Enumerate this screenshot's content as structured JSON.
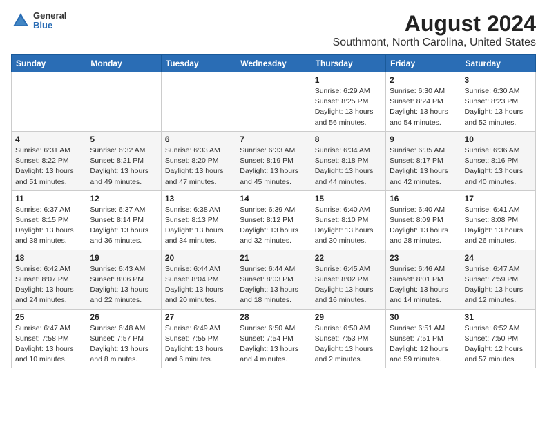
{
  "header": {
    "logo": {
      "general": "General",
      "blue": "Blue"
    },
    "title": "August 2024",
    "subtitle": "Southmont, North Carolina, United States"
  },
  "calendar": {
    "days_of_week": [
      "Sunday",
      "Monday",
      "Tuesday",
      "Wednesday",
      "Thursday",
      "Friday",
      "Saturday"
    ],
    "weeks": [
      [
        {
          "day": "",
          "info": ""
        },
        {
          "day": "",
          "info": ""
        },
        {
          "day": "",
          "info": ""
        },
        {
          "day": "",
          "info": ""
        },
        {
          "day": "1",
          "info": "Sunrise: 6:29 AM\nSunset: 8:25 PM\nDaylight: 13 hours\nand 56 minutes."
        },
        {
          "day": "2",
          "info": "Sunrise: 6:30 AM\nSunset: 8:24 PM\nDaylight: 13 hours\nand 54 minutes."
        },
        {
          "day": "3",
          "info": "Sunrise: 6:30 AM\nSunset: 8:23 PM\nDaylight: 13 hours\nand 52 minutes."
        }
      ],
      [
        {
          "day": "4",
          "info": "Sunrise: 6:31 AM\nSunset: 8:22 PM\nDaylight: 13 hours\nand 51 minutes."
        },
        {
          "day": "5",
          "info": "Sunrise: 6:32 AM\nSunset: 8:21 PM\nDaylight: 13 hours\nand 49 minutes."
        },
        {
          "day": "6",
          "info": "Sunrise: 6:33 AM\nSunset: 8:20 PM\nDaylight: 13 hours\nand 47 minutes."
        },
        {
          "day": "7",
          "info": "Sunrise: 6:33 AM\nSunset: 8:19 PM\nDaylight: 13 hours\nand 45 minutes."
        },
        {
          "day": "8",
          "info": "Sunrise: 6:34 AM\nSunset: 8:18 PM\nDaylight: 13 hours\nand 44 minutes."
        },
        {
          "day": "9",
          "info": "Sunrise: 6:35 AM\nSunset: 8:17 PM\nDaylight: 13 hours\nand 42 minutes."
        },
        {
          "day": "10",
          "info": "Sunrise: 6:36 AM\nSunset: 8:16 PM\nDaylight: 13 hours\nand 40 minutes."
        }
      ],
      [
        {
          "day": "11",
          "info": "Sunrise: 6:37 AM\nSunset: 8:15 PM\nDaylight: 13 hours\nand 38 minutes."
        },
        {
          "day": "12",
          "info": "Sunrise: 6:37 AM\nSunset: 8:14 PM\nDaylight: 13 hours\nand 36 minutes."
        },
        {
          "day": "13",
          "info": "Sunrise: 6:38 AM\nSunset: 8:13 PM\nDaylight: 13 hours\nand 34 minutes."
        },
        {
          "day": "14",
          "info": "Sunrise: 6:39 AM\nSunset: 8:12 PM\nDaylight: 13 hours\nand 32 minutes."
        },
        {
          "day": "15",
          "info": "Sunrise: 6:40 AM\nSunset: 8:10 PM\nDaylight: 13 hours\nand 30 minutes."
        },
        {
          "day": "16",
          "info": "Sunrise: 6:40 AM\nSunset: 8:09 PM\nDaylight: 13 hours\nand 28 minutes."
        },
        {
          "day": "17",
          "info": "Sunrise: 6:41 AM\nSunset: 8:08 PM\nDaylight: 13 hours\nand 26 minutes."
        }
      ],
      [
        {
          "day": "18",
          "info": "Sunrise: 6:42 AM\nSunset: 8:07 PM\nDaylight: 13 hours\nand 24 minutes."
        },
        {
          "day": "19",
          "info": "Sunrise: 6:43 AM\nSunset: 8:06 PM\nDaylight: 13 hours\nand 22 minutes."
        },
        {
          "day": "20",
          "info": "Sunrise: 6:44 AM\nSunset: 8:04 PM\nDaylight: 13 hours\nand 20 minutes."
        },
        {
          "day": "21",
          "info": "Sunrise: 6:44 AM\nSunset: 8:03 PM\nDaylight: 13 hours\nand 18 minutes."
        },
        {
          "day": "22",
          "info": "Sunrise: 6:45 AM\nSunset: 8:02 PM\nDaylight: 13 hours\nand 16 minutes."
        },
        {
          "day": "23",
          "info": "Sunrise: 6:46 AM\nSunset: 8:01 PM\nDaylight: 13 hours\nand 14 minutes."
        },
        {
          "day": "24",
          "info": "Sunrise: 6:47 AM\nSunset: 7:59 PM\nDaylight: 13 hours\nand 12 minutes."
        }
      ],
      [
        {
          "day": "25",
          "info": "Sunrise: 6:47 AM\nSunset: 7:58 PM\nDaylight: 13 hours\nand 10 minutes."
        },
        {
          "day": "26",
          "info": "Sunrise: 6:48 AM\nSunset: 7:57 PM\nDaylight: 13 hours\nand 8 minutes."
        },
        {
          "day": "27",
          "info": "Sunrise: 6:49 AM\nSunset: 7:55 PM\nDaylight: 13 hours\nand 6 minutes."
        },
        {
          "day": "28",
          "info": "Sunrise: 6:50 AM\nSunset: 7:54 PM\nDaylight: 13 hours\nand 4 minutes."
        },
        {
          "day": "29",
          "info": "Sunrise: 6:50 AM\nSunset: 7:53 PM\nDaylight: 13 hours\nand 2 minutes."
        },
        {
          "day": "30",
          "info": "Sunrise: 6:51 AM\nSunset: 7:51 PM\nDaylight: 12 hours\nand 59 minutes."
        },
        {
          "day": "31",
          "info": "Sunrise: 6:52 AM\nSunset: 7:50 PM\nDaylight: 12 hours\nand 57 minutes."
        }
      ]
    ]
  }
}
